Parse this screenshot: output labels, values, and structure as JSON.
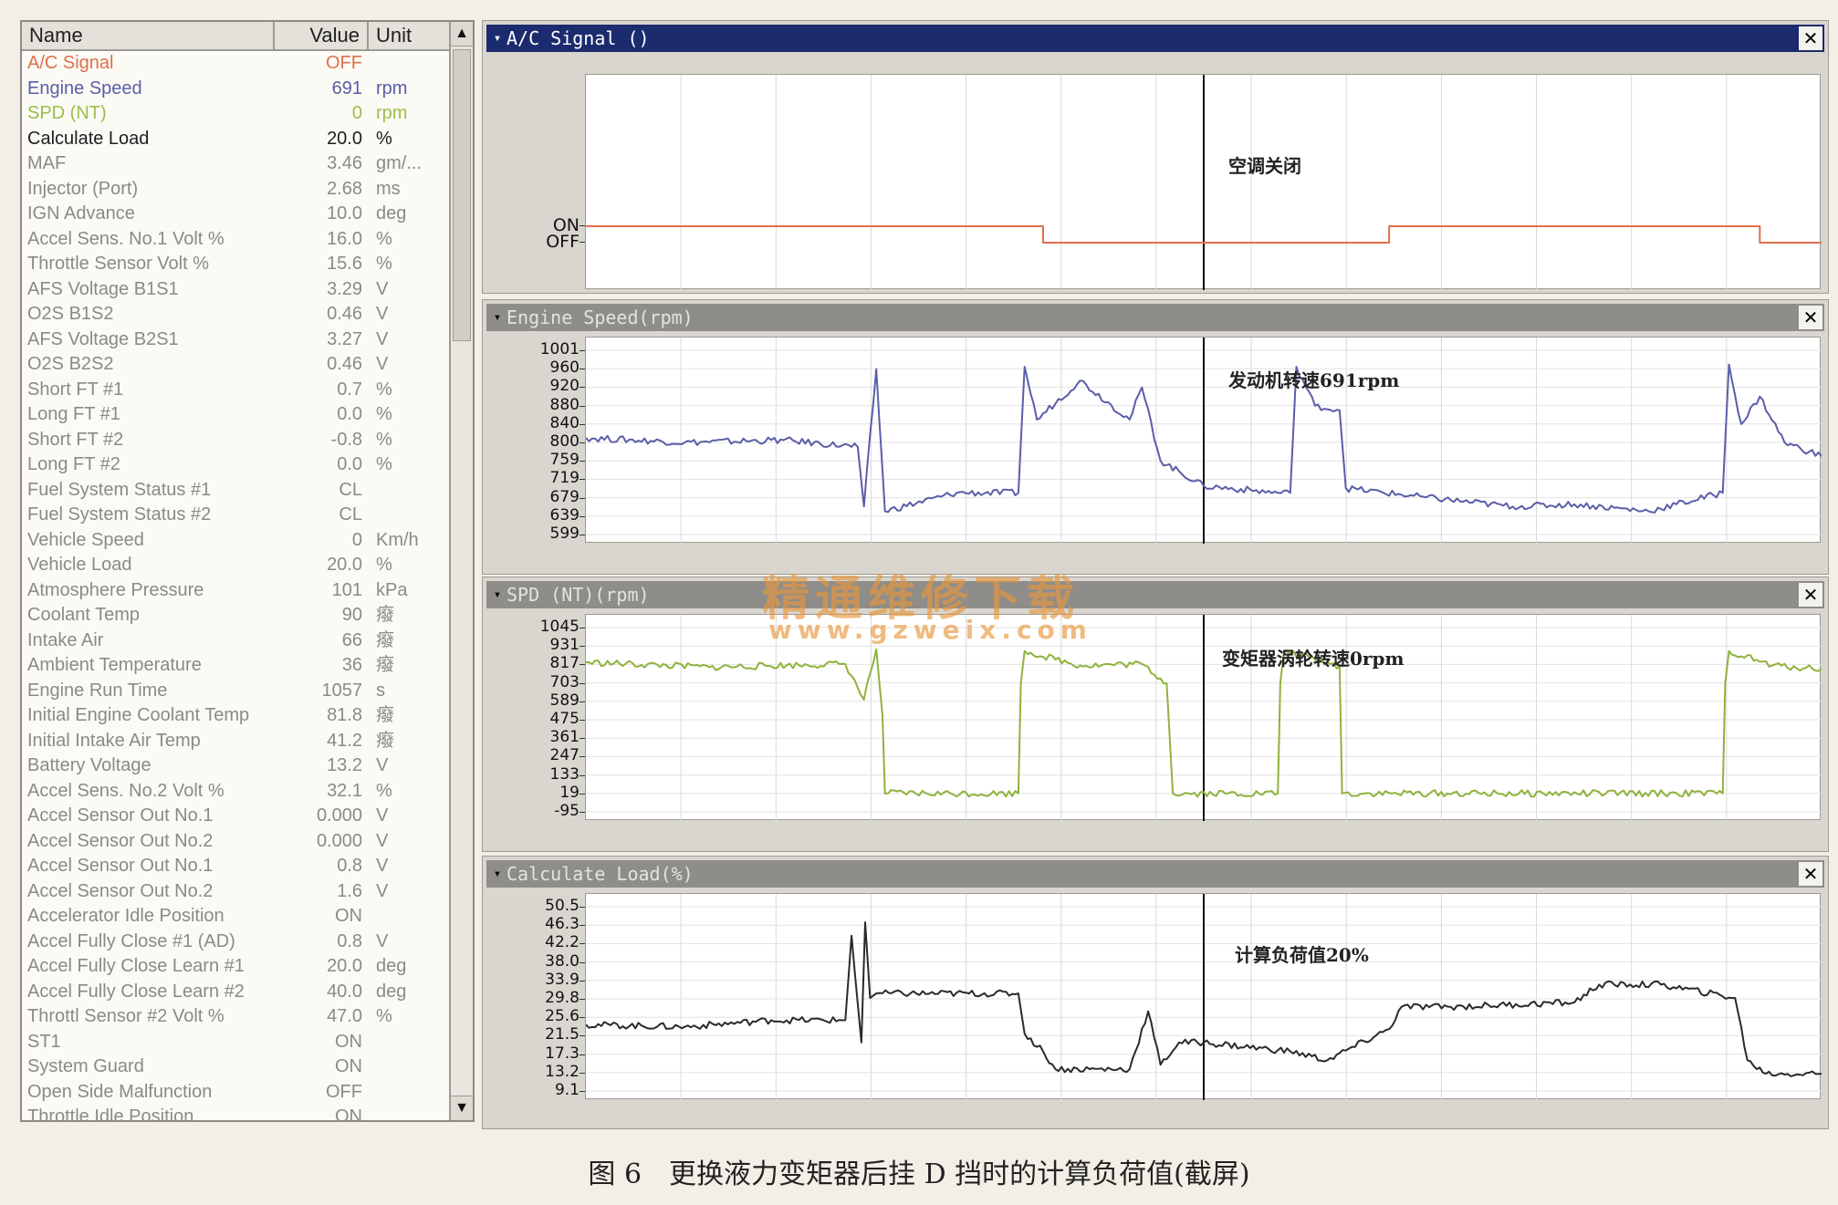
{
  "colors": {
    "ac_signal": "#e0704a",
    "engine_speed": "#5a5ea8",
    "spd_nt": "#8fb23c",
    "calculate_load": "#2a2a2a",
    "active_row": "#1e1e1e",
    "inactive_row": "#8a8a86",
    "title_active": "#1c2a6e",
    "title_inactive": "#8f8d89"
  },
  "list": {
    "headers": {
      "name": "Name",
      "value": "Value",
      "unit": "Unit"
    },
    "rows": [
      {
        "name": "A/C Signal",
        "value": "OFF",
        "unit": "",
        "color": "#e0704a"
      },
      {
        "name": "Engine Speed",
        "value": "691",
        "unit": "rpm",
        "color": "#5a5ea8"
      },
      {
        "name": "SPD (NT)",
        "value": "0",
        "unit": "rpm",
        "color": "#9bbf4a"
      },
      {
        "name": "Calculate Load",
        "value": "20.0",
        "unit": "%",
        "color": "#1e1e1e"
      },
      {
        "name": "MAF",
        "value": "3.46",
        "unit": "gm/...",
        "color": "#8a8a86"
      },
      {
        "name": "Injector (Port)",
        "value": "2.68",
        "unit": "ms",
        "color": "#8a8a86"
      },
      {
        "name": "IGN Advance",
        "value": "10.0",
        "unit": "deg",
        "color": "#8a8a86"
      },
      {
        "name": "Accel Sens. No.1 Volt %",
        "value": "16.0",
        "unit": "%",
        "color": "#8a8a86"
      },
      {
        "name": "Throttle Sensor Volt %",
        "value": "15.6",
        "unit": "%",
        "color": "#8a8a86"
      },
      {
        "name": "AFS Voltage B1S1",
        "value": "3.29",
        "unit": "V",
        "color": "#8a8a86"
      },
      {
        "name": "O2S B1S2",
        "value": "0.46",
        "unit": "V",
        "color": "#8a8a86"
      },
      {
        "name": "AFS Voltage B2S1",
        "value": "3.27",
        "unit": "V",
        "color": "#8a8a86"
      },
      {
        "name": "O2S B2S2",
        "value": "0.46",
        "unit": "V",
        "color": "#8a8a86"
      },
      {
        "name": "Short FT #1",
        "value": "0.7",
        "unit": "%",
        "color": "#8a8a86"
      },
      {
        "name": "Long FT #1",
        "value": "0.0",
        "unit": "%",
        "color": "#8a8a86"
      },
      {
        "name": "Short FT #2",
        "value": "-0.8",
        "unit": "%",
        "color": "#8a8a86"
      },
      {
        "name": "Long FT #2",
        "value": "0.0",
        "unit": "%",
        "color": "#8a8a86"
      },
      {
        "name": "Fuel System Status #1",
        "value": "CL",
        "unit": "",
        "color": "#8a8a86"
      },
      {
        "name": "Fuel System Status #2",
        "value": "CL",
        "unit": "",
        "color": "#8a8a86"
      },
      {
        "name": "Vehicle Speed",
        "value": "0",
        "unit": "Km/h",
        "color": "#8a8a86"
      },
      {
        "name": "Vehicle Load",
        "value": "20.0",
        "unit": "%",
        "color": "#8a8a86"
      },
      {
        "name": "Atmosphere Pressure",
        "value": "101",
        "unit": "kPa",
        "color": "#8a8a86"
      },
      {
        "name": "Coolant Temp",
        "value": "90",
        "unit": "癈",
        "color": "#8a8a86"
      },
      {
        "name": "Intake Air",
        "value": "66",
        "unit": "癈",
        "color": "#8a8a86"
      },
      {
        "name": "Ambient Temperature",
        "value": "36",
        "unit": "癈",
        "color": "#8a8a86"
      },
      {
        "name": "Engine Run Time",
        "value": "1057",
        "unit": "s",
        "color": "#8a8a86"
      },
      {
        "name": "Initial Engine Coolant Temp",
        "value": "81.8",
        "unit": "癈",
        "color": "#8a8a86"
      },
      {
        "name": "Initial Intake Air Temp",
        "value": "41.2",
        "unit": "癈",
        "color": "#8a8a86"
      },
      {
        "name": "Battery Voltage",
        "value": "13.2",
        "unit": "V",
        "color": "#8a8a86"
      },
      {
        "name": "Accel Sens. No.2 Volt %",
        "value": "32.1",
        "unit": "%",
        "color": "#8a8a86"
      },
      {
        "name": "Accel Sensor Out No.1",
        "value": "0.000",
        "unit": "V",
        "color": "#8a8a86"
      },
      {
        "name": "Accel Sensor Out No.2",
        "value": "0.000",
        "unit": "V",
        "color": "#8a8a86"
      },
      {
        "name": "Accel Sensor Out No.1",
        "value": "0.8",
        "unit": "V",
        "color": "#8a8a86"
      },
      {
        "name": "Accel Sensor Out No.2",
        "value": "1.6",
        "unit": "V",
        "color": "#8a8a86"
      },
      {
        "name": "Accelerator Idle Position",
        "value": "ON",
        "unit": "",
        "color": "#8a8a86"
      },
      {
        "name": "Accel Fully Close #1 (AD)",
        "value": "0.8",
        "unit": "V",
        "color": "#8a8a86"
      },
      {
        "name": "Accel Fully Close Learn #1",
        "value": "20.0",
        "unit": "deg",
        "color": "#8a8a86"
      },
      {
        "name": "Accel Fully Close Learn #2",
        "value": "40.0",
        "unit": "deg",
        "color": "#8a8a86"
      },
      {
        "name": "Throttl Sensor #2 Volt %",
        "value": "47.0",
        "unit": "%",
        "color": "#8a8a86"
      },
      {
        "name": "ST1",
        "value": "ON",
        "unit": "",
        "color": "#8a8a86"
      },
      {
        "name": "System Guard",
        "value": "ON",
        "unit": "",
        "color": "#8a8a86"
      },
      {
        "name": "Open Side Malfunction",
        "value": "OFF",
        "unit": "",
        "color": "#8a8a86"
      },
      {
        "name": "Throttle Idle Position",
        "value": "ON",
        "unit": "",
        "color": "#8a8a86"
      }
    ],
    "scroll_up_icon": "▲",
    "scroll_down_icon": "▼"
  },
  "panels": [
    {
      "title": "A/C Signal ()",
      "active": true,
      "annotation": "空调关闭",
      "y_labels": [
        "ON",
        "OFF"
      ]
    },
    {
      "title": "Engine Speed(rpm)",
      "active": false,
      "annotation": "发动机转速691rpm",
      "y_labels": [
        "1001",
        "960",
        "920",
        "880",
        "840",
        "800",
        "759",
        "719",
        "679",
        "639",
        "599"
      ]
    },
    {
      "title": "SPD (NT)(rpm)",
      "active": false,
      "annotation": "变矩器涡轮转速0rpm",
      "y_labels": [
        "1045",
        "931",
        "817",
        "703",
        "589",
        "475",
        "361",
        "247",
        "133",
        "19",
        "-95"
      ]
    },
    {
      "title": "Calculate Load(%)",
      "active": false,
      "annotation": "计算负荷值20%",
      "y_labels": [
        "50.5",
        "46.3",
        "42.2",
        "38.0",
        "33.9",
        "29.8",
        "25.6",
        "21.5",
        "17.3",
        "13.2",
        "9.1"
      ]
    }
  ],
  "close_icon": "✕",
  "collapse_icon": "▾",
  "chart_data": [
    {
      "type": "line",
      "title": "A/C Signal ()",
      "x": [
        0,
        37,
        38,
        64,
        65,
        100
      ],
      "series": [
        {
          "values": [
            1,
            1,
            0,
            0,
            1,
            1
          ]
        }
      ],
      "note_pattern": "ON until 37%, OFF 37-65%, ON 65-95%, OFF after 95%"
    },
    {
      "type": "line",
      "title": "Engine Speed(rpm)",
      "ylim": [
        599,
        1001
      ],
      "x": [
        0,
        8,
        16,
        22,
        22.5,
        23.5,
        24.2,
        30,
        35,
        35.5,
        36.5,
        40,
        44,
        45,
        46.5,
        50,
        56,
        57,
        57.5,
        59,
        61,
        61.5,
        68,
        75,
        80,
        86,
        92,
        92.5,
        93.5,
        95,
        97,
        100
      ],
      "series": [
        {
          "name": "Engine Speed",
          "values": [
            810,
            800,
            805,
            790,
            660,
            960,
            650,
            690,
            690,
            965,
            850,
            935,
            850,
            920,
            760,
            705,
            690,
            690,
            965,
            880,
            870,
            700,
            680,
            660,
            665,
            650,
            690,
            970,
            840,
            900,
            800,
            770
          ]
        }
      ]
    },
    {
      "type": "line",
      "title": "SPD (NT)(rpm)",
      "ylim": [
        -95,
        1045
      ],
      "x": [
        0,
        10,
        21,
        22.5,
        23.5,
        24,
        24.2,
        35,
        35.2,
        35.5,
        40,
        45,
        47,
        47.5,
        56,
        56.2,
        56.5,
        60,
        61,
        61.2,
        92,
        92.2,
        92.5,
        96,
        100
      ],
      "series": [
        {
          "name": "SPD (NT)",
          "values": [
            830,
            800,
            820,
            600,
            910,
            500,
            19,
            19,
            700,
            900,
            810,
            820,
            700,
            19,
            19,
            700,
            900,
            830,
            800,
            19,
            19,
            700,
            900,
            810,
            790
          ]
        }
      ]
    },
    {
      "type": "line",
      "title": "Calculate Load(%)",
      "ylim": [
        9.1,
        50.5
      ],
      "x": [
        0,
        8,
        15,
        21,
        21.5,
        22.3,
        22.6,
        23,
        23.5,
        35,
        35.5,
        37,
        38,
        44,
        45.5,
        46.5,
        48,
        50,
        57,
        60,
        65,
        66,
        70,
        80,
        82,
        87,
        93,
        94,
        95.5,
        100
      ],
      "series": [
        {
          "name": "Calculate Load",
          "values": [
            24,
            23.5,
            25,
            25,
            44,
            20,
            47,
            30,
            31,
            31,
            22,
            18,
            14,
            14,
            27,
            15,
            20,
            20,
            18,
            16,
            23,
            28,
            28,
            29,
            33,
            33,
            30,
            16,
            13,
            13
          ]
        }
      ]
    }
  ],
  "watermark": {
    "cn": "精通维修下载",
    "url": "www.gzweix.com"
  },
  "caption": "图 6　更换液力变矩器后挂 D 挡时的计算负荷值(截屏)"
}
